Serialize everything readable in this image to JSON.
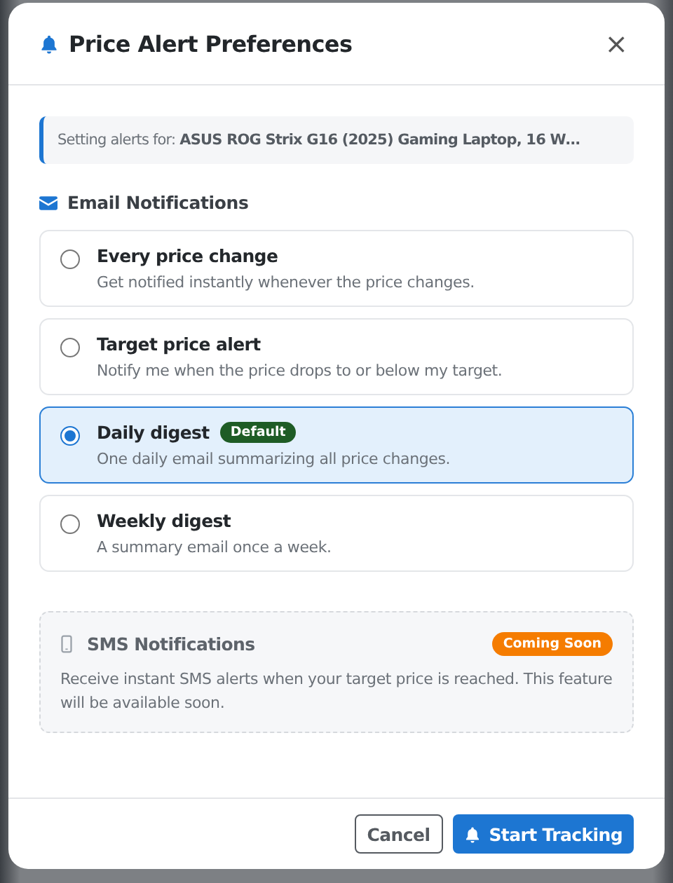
{
  "dialog": {
    "title": "Price Alert Preferences",
    "close": "×"
  },
  "product": {
    "label": "Setting alerts for:",
    "name": "ASUS ROG Strix G16 (2025) Gaming Laptop, 16 W…"
  },
  "email": {
    "heading": "Email Notifications",
    "options": [
      {
        "title": "Every price change",
        "description": "Get notified instantly whenever the price changes.",
        "selected": false
      },
      {
        "title": "Target price alert",
        "description": "Notify me when the price drops to or below my target.",
        "selected": false
      },
      {
        "title": "Daily digest",
        "badge": "Default",
        "description": "One daily email summarizing all price changes.",
        "selected": true
      },
      {
        "title": "Weekly digest",
        "description": "A summary email once a week.",
        "selected": false
      }
    ]
  },
  "sms": {
    "heading": "SMS Notifications",
    "badge": "Coming Soon",
    "description": "Receive instant SMS alerts when your target price is reached. This feature will be available soon."
  },
  "buttons": [
    {
      "kind": "secondary",
      "label": "Cancel"
    },
    {
      "kind": "primary",
      "label": "Start Tracking"
    }
  ]
}
